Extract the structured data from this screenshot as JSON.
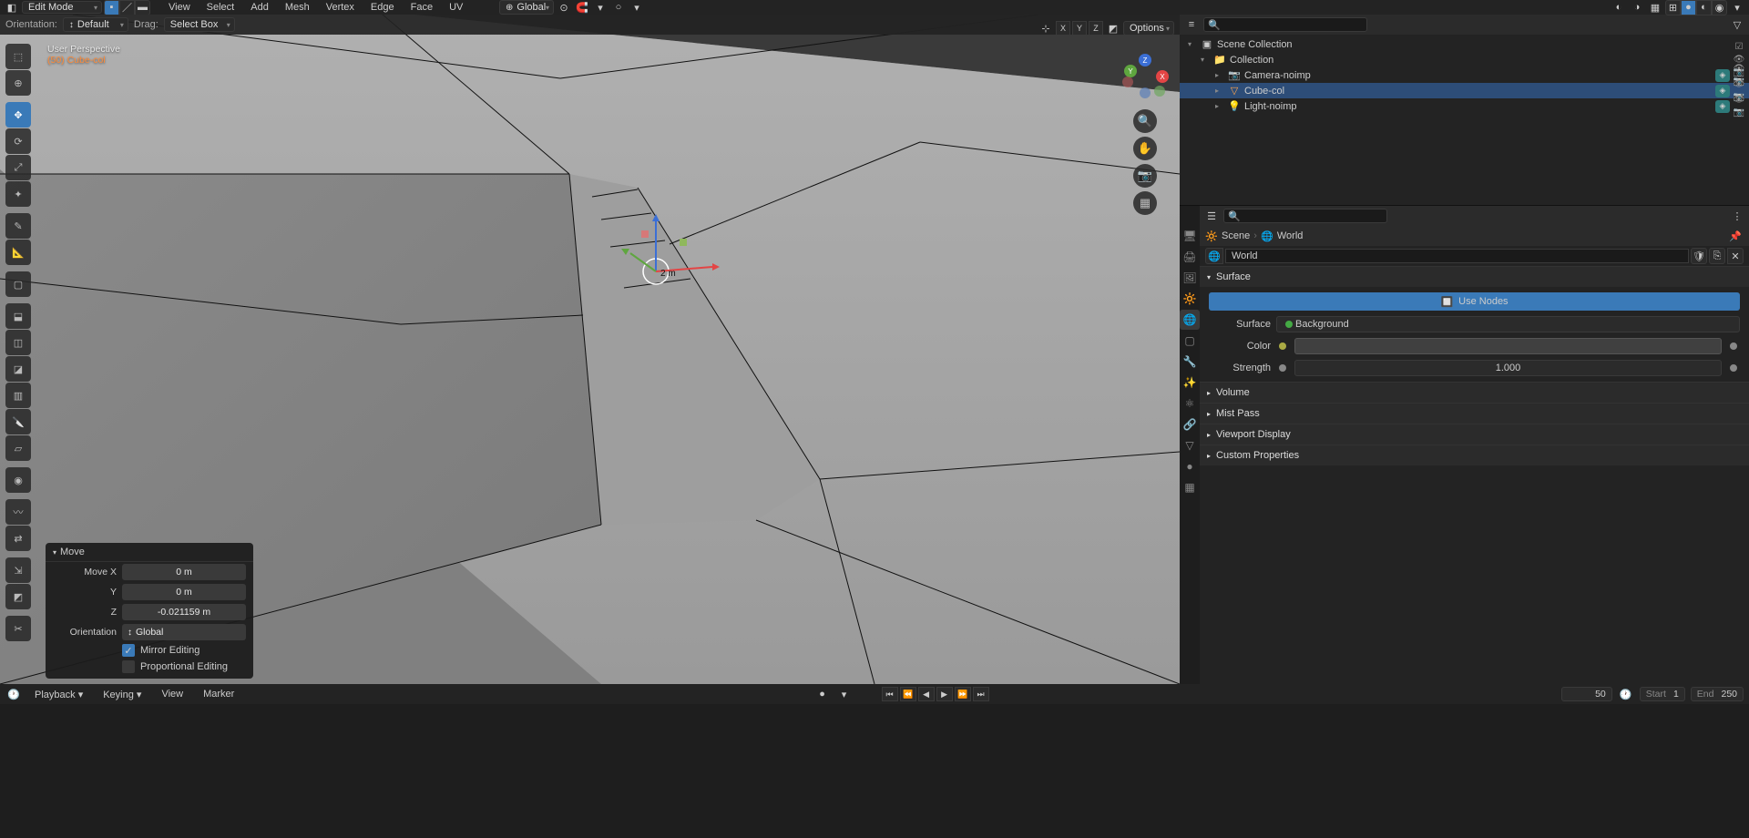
{
  "top": {
    "mode": "Edit Mode",
    "orientation": "Global",
    "menus": [
      "View",
      "Select",
      "Add",
      "Mesh",
      "Vertex",
      "Edge",
      "Face",
      "UV"
    ]
  },
  "header2": {
    "orient_label": "Orientation:",
    "orient_val": "Default",
    "drag_label": "Drag:",
    "drag_val": "Select Box"
  },
  "overlay": {
    "persp": "User Perspective",
    "obj": "(50) Cube-col",
    "options": "Options"
  },
  "gizmo_label": "2 m",
  "axes": {
    "x": "X",
    "y": "Y",
    "z": "Z"
  },
  "operator": {
    "title": "Move",
    "rows": [
      {
        "label": "Move X",
        "value": "0 m"
      },
      {
        "label": "Y",
        "value": "0 m"
      },
      {
        "label": "Z",
        "value": "-0.021159 m"
      }
    ],
    "orient_label": "Orientation",
    "orient_val": "Global",
    "mirror": "Mirror Editing",
    "prop": "Proportional Editing"
  },
  "outliner": {
    "title": "Scene Collection",
    "items": [
      {
        "depth": 0,
        "icon": "📁",
        "name": "Collection",
        "ic_col": "#fff"
      },
      {
        "depth": 1,
        "icon": "📷",
        "name": "Camera-noimp",
        "ic_col": "#ffa54e"
      },
      {
        "depth": 1,
        "icon": "▽",
        "name": "Cube-col",
        "sel": true,
        "ic_col": "#ffa54e"
      },
      {
        "depth": 1,
        "icon": "💡",
        "name": "Light-noimp",
        "ic_col": "#ffa54e"
      }
    ]
  },
  "props": {
    "search_ph": "",
    "bc_scene": "Scene",
    "bc_world": "World",
    "world_name": "World",
    "surface": "Surface",
    "use_nodes": "Use Nodes",
    "surf_label": "Surface",
    "surf_val": "Background",
    "color_label": "Color",
    "strength_label": "Strength",
    "strength_val": "1.000",
    "sections": [
      "Volume",
      "Mist Pass",
      "Viewport Display",
      "Custom Properties"
    ]
  },
  "timeline": {
    "playback": "Playback",
    "keying": "Keying",
    "view": "View",
    "marker": "Marker",
    "frame": "50",
    "start_label": "Start",
    "start": "1",
    "end_label": "End",
    "end": "250"
  }
}
